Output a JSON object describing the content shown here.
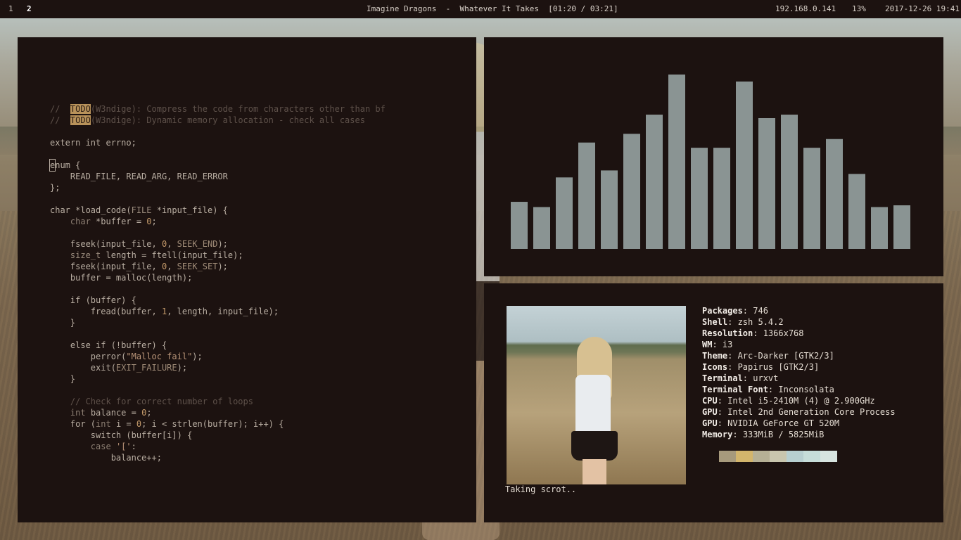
{
  "topbar": {
    "workspaces": [
      "1",
      "2"
    ],
    "active_workspace": "2",
    "now_playing": "Imagine Dragons  -  Whatever It Takes  [01:20 / 03:21]",
    "ip": "192.168.0.141",
    "volume": "13%",
    "datetime": "2017-12-26 19:41"
  },
  "editor": {
    "lines": [
      [
        {
          "t": "//  ",
          "c": "cm"
        },
        {
          "t": "TODO",
          "c": "todo"
        },
        {
          "t": "(W3ndige): Compress the code from characters other than bf",
          "c": "cm"
        }
      ],
      [
        {
          "t": "//  ",
          "c": "cm"
        },
        {
          "t": "TODO",
          "c": "todo"
        },
        {
          "t": "(W3ndige): Dynamic memory allocation - check all cases",
          "c": "cm"
        }
      ],
      [],
      [
        {
          "t": "extern int errno;",
          "c": ""
        }
      ],
      [],
      [
        {
          "t": "e",
          "c": "cursor"
        },
        {
          "t": "num {",
          "c": ""
        }
      ],
      [
        {
          "t": "    READ_FILE, READ_ARG, READ_ERROR",
          "c": ""
        }
      ],
      [
        {
          "t": "};",
          "c": ""
        }
      ],
      [],
      [
        {
          "t": "char *load_code(",
          "c": ""
        },
        {
          "t": "FILE",
          "c": "ty"
        },
        {
          "t": " *input_file) {",
          "c": ""
        }
      ],
      [
        {
          "t": "    ",
          "c": ""
        },
        {
          "t": "char",
          "c": "kw"
        },
        {
          "t": " *buffer = ",
          "c": ""
        },
        {
          "t": "0",
          "c": "num"
        },
        {
          "t": ";",
          "c": ""
        }
      ],
      [],
      [
        {
          "t": "    fseek(input_file, ",
          "c": ""
        },
        {
          "t": "0",
          "c": "num"
        },
        {
          "t": ", ",
          "c": ""
        },
        {
          "t": "SEEK_END",
          "c": "cst"
        },
        {
          "t": ");",
          "c": ""
        }
      ],
      [
        {
          "t": "    ",
          "c": ""
        },
        {
          "t": "size_t",
          "c": "ty"
        },
        {
          "t": " length = ftell(input_file);",
          "c": ""
        }
      ],
      [
        {
          "t": "    fseek(input_file, ",
          "c": ""
        },
        {
          "t": "0",
          "c": "num"
        },
        {
          "t": ", ",
          "c": ""
        },
        {
          "t": "SEEK_SET",
          "c": "cst"
        },
        {
          "t": ");",
          "c": ""
        }
      ],
      [
        {
          "t": "    buffer = malloc(length);",
          "c": ""
        }
      ],
      [],
      [
        {
          "t": "    if (buffer) {",
          "c": ""
        }
      ],
      [
        {
          "t": "        fread(buffer, ",
          "c": ""
        },
        {
          "t": "1",
          "c": "num"
        },
        {
          "t": ", length, input_file);",
          "c": ""
        }
      ],
      [
        {
          "t": "    }",
          "c": ""
        }
      ],
      [],
      [
        {
          "t": "    else if (!buffer) {",
          "c": ""
        }
      ],
      [
        {
          "t": "        perror(",
          "c": ""
        },
        {
          "t": "\"Malloc fail\"",
          "c": "str"
        },
        {
          "t": ");",
          "c": ""
        }
      ],
      [
        {
          "t": "        exit(",
          "c": ""
        },
        {
          "t": "EXIT_FAILURE",
          "c": "cst"
        },
        {
          "t": ");",
          "c": ""
        }
      ],
      [
        {
          "t": "    }",
          "c": ""
        }
      ],
      [],
      [
        {
          "t": "    // Check for correct number of loops",
          "c": "cm"
        }
      ],
      [
        {
          "t": "    ",
          "c": ""
        },
        {
          "t": "int",
          "c": "kw"
        },
        {
          "t": " balance = ",
          "c": ""
        },
        {
          "t": "0",
          "c": "num"
        },
        {
          "t": ";",
          "c": ""
        }
      ],
      [
        {
          "t": "    for (",
          "c": ""
        },
        {
          "t": "int",
          "c": "kw"
        },
        {
          "t": " i = ",
          "c": ""
        },
        {
          "t": "0",
          "c": "num"
        },
        {
          "t": "; i < strlen(buffer); i++) {",
          "c": ""
        }
      ],
      [
        {
          "t": "        switch (buffer[i]) {",
          "c": ""
        }
      ],
      [
        {
          "t": "        ",
          "c": ""
        },
        {
          "t": "case",
          "c": "kw"
        },
        {
          "t": " ",
          "c": ""
        },
        {
          "t": "'['",
          "c": "str"
        },
        {
          "t": ":",
          "c": ""
        }
      ],
      [
        {
          "t": "            balance++;",
          "c": ""
        }
      ]
    ]
  },
  "visualizer": {
    "bar_color": "#8a9493",
    "levels": [
      0.27,
      0.24,
      0.41,
      0.61,
      0.45,
      0.66,
      0.77,
      1.0,
      0.58,
      0.58,
      0.96,
      0.75,
      0.77,
      0.58,
      0.63,
      0.43,
      0.24,
      0.25
    ]
  },
  "fetch": {
    "info": [
      {
        "key": "Packages",
        "value": "746"
      },
      {
        "key": "Shell",
        "value": "zsh 5.4.2"
      },
      {
        "key": "Resolution",
        "value": "1366x768"
      },
      {
        "key": "WM",
        "value": "i3"
      },
      {
        "key": "Theme",
        "value": "Arc-Darker [GTK2/3]"
      },
      {
        "key": "Icons",
        "value": "Papirus [GTK2/3]"
      },
      {
        "key": "Terminal",
        "value": "urxvt"
      },
      {
        "key": "Terminal Font",
        "value": "Inconsolata"
      },
      {
        "key": "CPU",
        "value": "Intel i5-2410M (4) @ 2.900GHz"
      },
      {
        "key": "GPU",
        "value": "Intel 2nd Generation Core Process"
      },
      {
        "key": "GPU",
        "value": "NVIDIA GeForce GT 520M"
      },
      {
        "key": "Memory",
        "value": "333MiB / 5825MiB"
      }
    ],
    "palette": [
      "#a79a7c",
      "#d3b56c",
      "#b6b095",
      "#c9c6ae",
      "#b7cfd0",
      "#c6ddd9",
      "#d7e4e0"
    ],
    "status": "Taking scrot.."
  }
}
